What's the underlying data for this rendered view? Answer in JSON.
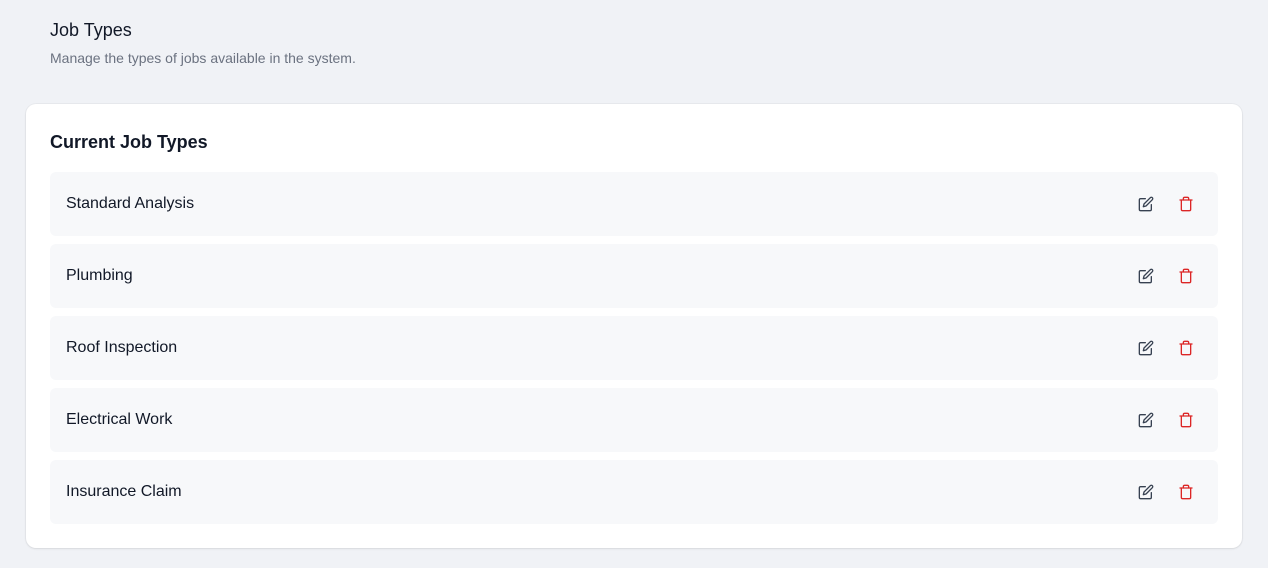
{
  "header": {
    "title": "Job Types",
    "subtitle": "Manage the types of jobs available in the system."
  },
  "card": {
    "title": "Current Job Types"
  },
  "job_types": [
    {
      "name": "Standard Analysis",
      "actions": [
        "edit-icon",
        "trash-icon"
      ]
    },
    {
      "name": "Plumbing",
      "actions": [
        "edit-icon",
        "trash-icon"
      ]
    },
    {
      "name": "Roof Inspection",
      "actions": [
        "edit-icon",
        "trash-icon"
      ]
    },
    {
      "name": "Electrical Work",
      "actions": [
        "edit-icon",
        "trash-icon"
      ]
    },
    {
      "name": "Insurance Claim",
      "actions": [
        "edit-icon",
        "trash-icon"
      ]
    }
  ],
  "colors": {
    "background": "#f0f2f6",
    "card": "#ffffff",
    "row": "#f7f8fa",
    "edit_icon": "#374151",
    "delete_icon": "#dc2626"
  }
}
